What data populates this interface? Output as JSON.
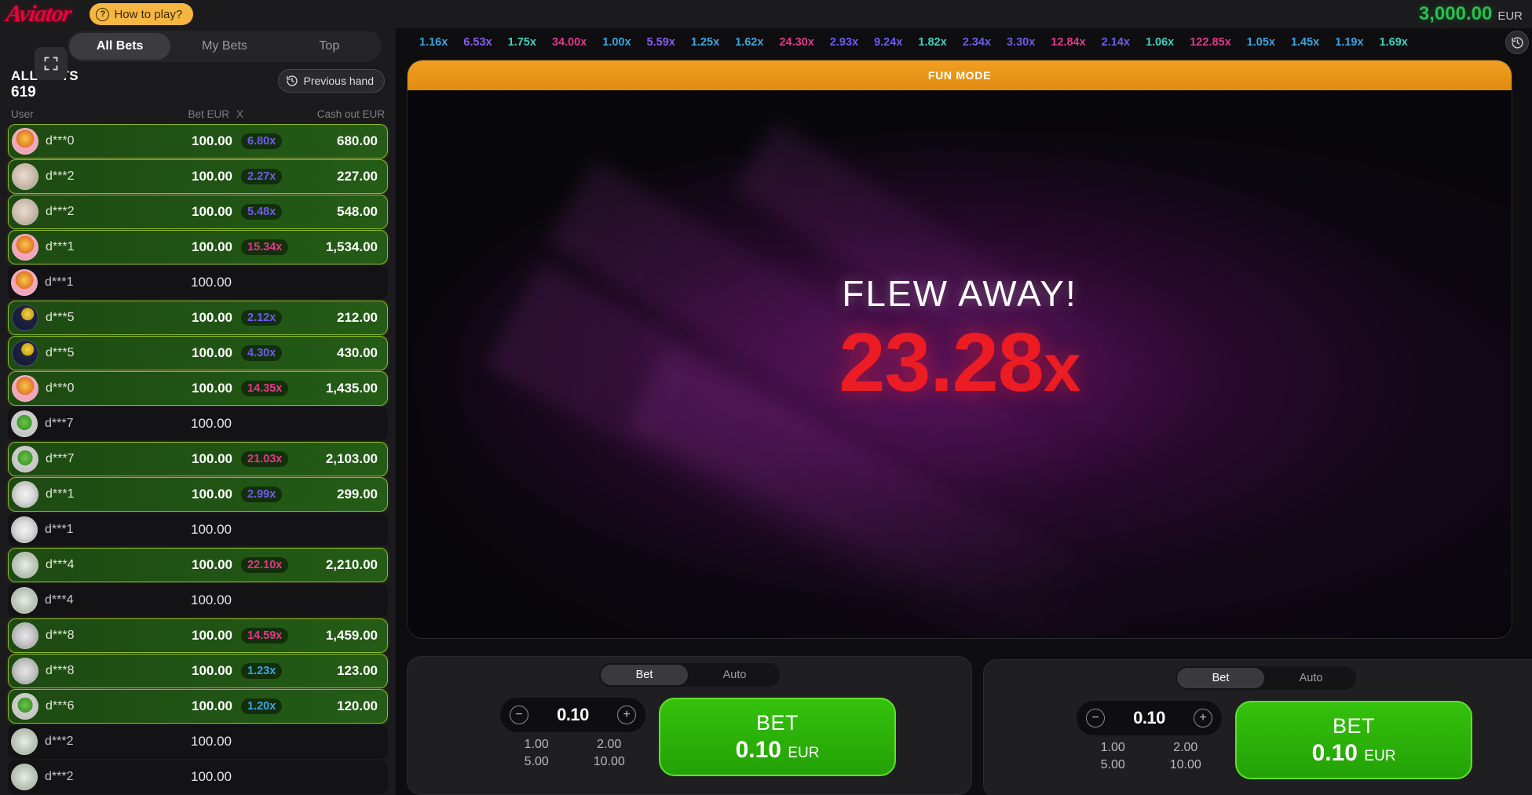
{
  "topbar": {
    "logo": "Aviator",
    "how_to_play": "How to play?",
    "how_to_play_icon": "question-mark-icon",
    "balance_amount": "3,000.00",
    "balance_currency": "EUR"
  },
  "left_panel": {
    "fullscreen_icon": "fullscreen-icon",
    "tabs": [
      {
        "label": "All Bets",
        "active": true
      },
      {
        "label": "My Bets",
        "active": false
      },
      {
        "label": "Top",
        "active": false
      }
    ],
    "all_bets_label": "ALL BETS",
    "all_bets_count": "619",
    "previous_hand_label": "Previous hand",
    "previous_hand_icon": "history-clock-icon",
    "columns": {
      "user": "User",
      "bet": "Bet EUR",
      "x": "X",
      "cash_out": "Cash out EUR"
    },
    "rows": [
      {
        "user": "d***0",
        "bet": "100.00",
        "x": "6.80x",
        "cash": "680.00",
        "won": true,
        "x_color": "#6f5bf0",
        "avatar": "cat"
      },
      {
        "user": "d***2",
        "bet": "100.00",
        "x": "2.27x",
        "cash": "227.00",
        "won": true,
        "x_color": "#6f5bf0",
        "avatar": "thumb"
      },
      {
        "user": "d***2",
        "bet": "100.00",
        "x": "5.48x",
        "cash": "548.00",
        "won": true,
        "x_color": "#6f5bf0",
        "avatar": "thumb"
      },
      {
        "user": "d***1",
        "bet": "100.00",
        "x": "15.34x",
        "cash": "1,534.00",
        "won": true,
        "x_color": "#e0398a",
        "avatar": "cat"
      },
      {
        "user": "d***1",
        "bet": "100.00",
        "x": "",
        "cash": "",
        "won": false,
        "x_color": "",
        "avatar": "cat"
      },
      {
        "user": "d***5",
        "bet": "100.00",
        "x": "2.12x",
        "cash": "212.00",
        "won": true,
        "x_color": "#6f5bf0",
        "avatar": "moon"
      },
      {
        "user": "d***5",
        "bet": "100.00",
        "x": "4.30x",
        "cash": "430.00",
        "won": true,
        "x_color": "#6f5bf0",
        "avatar": "moon"
      },
      {
        "user": "d***0",
        "bet": "100.00",
        "x": "14.35x",
        "cash": "1,435.00",
        "won": true,
        "x_color": "#e0398a",
        "avatar": "cat"
      },
      {
        "user": "d***7",
        "bet": "100.00",
        "x": "",
        "cash": "",
        "won": false,
        "x_color": "",
        "avatar": "clover"
      },
      {
        "user": "d***7",
        "bet": "100.00",
        "x": "21.03x",
        "cash": "2,103.00",
        "won": true,
        "x_color": "#e0398a",
        "avatar": "clover"
      },
      {
        "user": "d***1",
        "bet": "100.00",
        "x": "2.99x",
        "cash": "299.00",
        "won": true,
        "x_color": "#6f5bf0",
        "avatar": "plane"
      },
      {
        "user": "d***1",
        "bet": "100.00",
        "x": "",
        "cash": "",
        "won": false,
        "x_color": "",
        "avatar": "plane"
      },
      {
        "user": "d***4",
        "bet": "100.00",
        "x": "22.10x",
        "cash": "2,210.00",
        "won": true,
        "x_color": "#e0398a",
        "avatar": "money"
      },
      {
        "user": "d***4",
        "bet": "100.00",
        "x": "",
        "cash": "",
        "won": false,
        "x_color": "",
        "avatar": "money"
      },
      {
        "user": "d***8",
        "bet": "100.00",
        "x": "14.59x",
        "cash": "1,459.00",
        "won": true,
        "x_color": "#e0398a",
        "avatar": "plane2"
      },
      {
        "user": "d***8",
        "bet": "100.00",
        "x": "1.23x",
        "cash": "123.00",
        "won": true,
        "x_color": "#3ea4e0",
        "avatar": "plane2"
      },
      {
        "user": "d***6",
        "bet": "100.00",
        "x": "1.20x",
        "cash": "120.00",
        "won": true,
        "x_color": "#3ea4e0",
        "avatar": "clover"
      },
      {
        "user": "d***2",
        "bet": "100.00",
        "x": "",
        "cash": "",
        "won": false,
        "x_color": "",
        "avatar": "money"
      },
      {
        "user": "d***2",
        "bet": "100.00",
        "x": "",
        "cash": "",
        "won": false,
        "x_color": "",
        "avatar": "money"
      }
    ]
  },
  "game": {
    "history_icon": "history-clock-icon",
    "multiplier_history": [
      {
        "value": "1.16x",
        "color": "#3ea4e0"
      },
      {
        "value": "6.53x",
        "color": "#8a5bf0"
      },
      {
        "value": "1.75x",
        "color": "#3fd0c0"
      },
      {
        "value": "34.00x",
        "color": "#e0398a"
      },
      {
        "value": "1.00x",
        "color": "#3ea4e0"
      },
      {
        "value": "5.59x",
        "color": "#8a5bf0"
      },
      {
        "value": "1.25x",
        "color": "#3ea4e0"
      },
      {
        "value": "1.62x",
        "color": "#3ea4e0"
      },
      {
        "value": "24.30x",
        "color": "#e0398a"
      },
      {
        "value": "2.93x",
        "color": "#6f5bf0"
      },
      {
        "value": "9.24x",
        "color": "#6f5bf0"
      },
      {
        "value": "1.82x",
        "color": "#3fd0c0"
      },
      {
        "value": "2.34x",
        "color": "#6f5bf0"
      },
      {
        "value": "3.30x",
        "color": "#6f5bf0"
      },
      {
        "value": "12.84x",
        "color": "#e0398a"
      },
      {
        "value": "2.14x",
        "color": "#6f5bf0"
      },
      {
        "value": "1.06x",
        "color": "#3fd0c0"
      },
      {
        "value": "122.85x",
        "color": "#e0398a"
      },
      {
        "value": "1.05x",
        "color": "#3ea4e0"
      },
      {
        "value": "1.45x",
        "color": "#3ea4e0"
      },
      {
        "value": "1.19x",
        "color": "#3ea4e0"
      },
      {
        "value": "1.69x",
        "color": "#3fd0c0"
      }
    ],
    "fun_mode_label": "FUN MODE",
    "flew_away_label": "FLEW AWAY!",
    "crash_multiplier": "23.28",
    "crash_multiplier_suffix": "x"
  },
  "bet_panel_left": {
    "tab_bet": "Bet",
    "tab_auto": "Auto",
    "minus_icon": "minus-icon",
    "plus_icon": "plus-icon",
    "stake": "0.10",
    "quick_amounts": [
      "1.00",
      "2.00",
      "5.00",
      "10.00"
    ],
    "button_label": "BET",
    "button_amount": "0.10",
    "button_currency": "EUR"
  },
  "bet_panel_right": {
    "tab_bet": "Bet",
    "tab_auto": "Auto",
    "minus_icon": "minus-icon",
    "plus_icon": "plus-icon",
    "stake": "0.10",
    "quick_amounts": [
      "1.00",
      "2.00",
      "5.00",
      "10.00"
    ],
    "button_label": "BET",
    "button_amount": "0.10",
    "button_currency": "EUR"
  }
}
